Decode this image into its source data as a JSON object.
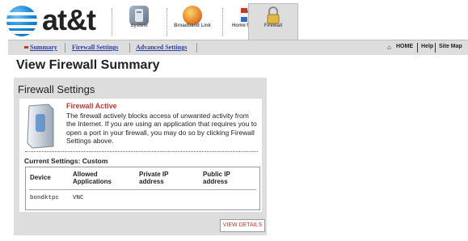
{
  "brand": {
    "name": "at&t"
  },
  "nav_tabs": [
    {
      "label": "System"
    },
    {
      "label": "Broadband Link"
    },
    {
      "label": "Home Network"
    },
    {
      "label": "Firewall"
    }
  ],
  "subnav": {
    "summary": "Summary",
    "firewall_settings": "Firewall Settings",
    "advanced_settings": "Advanced Settings",
    "home": "HOME",
    "help": "Help",
    "site_map": "Site Map"
  },
  "page": {
    "title": "View Firewall Summary"
  },
  "panel": {
    "title": "Firewall Settings",
    "status_heading": "Firewall Active",
    "description": "The firewall actively blocks access of unwanted activity from the Internet. If you are using an application that requires you to open a port in your firewall, you may do so by clicking Firewall Settings above.",
    "current_settings": "Current Settings: Custom",
    "table": {
      "headers": [
        "Device",
        "Allowed Applications",
        "Private IP address",
        "Public IP address"
      ],
      "rows": [
        [
          "bondktpc",
          "VNC",
          "",
          ""
        ]
      ]
    },
    "view_details": "VIEW DETAILS"
  },
  "colors": {
    "accent_red": "#c0392b",
    "link_blue": "#3040a8",
    "panel_gray": "#dddddd"
  }
}
